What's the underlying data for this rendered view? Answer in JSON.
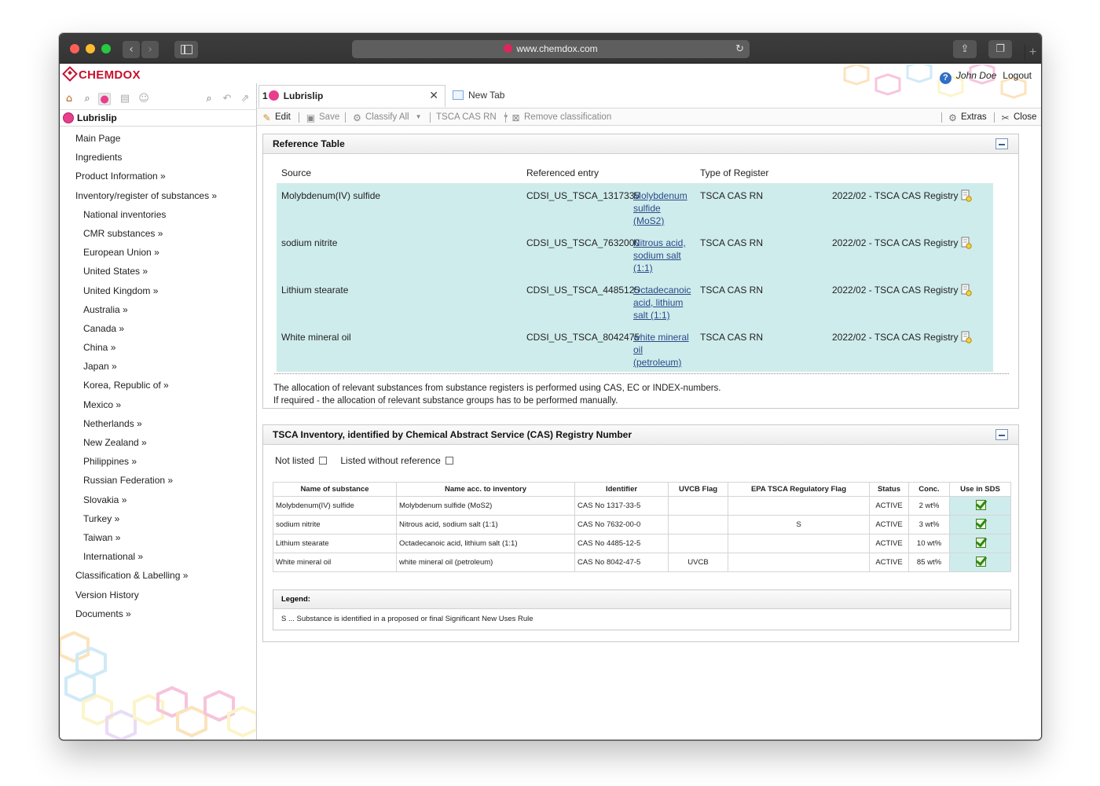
{
  "browser": {
    "url": "www.chemdox.com"
  },
  "app": {
    "logo": "CHEMDOX",
    "user_name": "John Doe",
    "logout": "Logout"
  },
  "left": {
    "title": "Lubrislip",
    "nav": [
      {
        "label": "Main Page",
        "level": 1
      },
      {
        "label": "Ingredients",
        "level": 1
      },
      {
        "label": "Product Information »",
        "level": 1
      },
      {
        "label": "Inventory/register of substances »",
        "level": 1
      },
      {
        "label": "National inventories",
        "level": 2
      },
      {
        "label": "CMR substances »",
        "level": 2
      },
      {
        "label": "European Union »",
        "level": 2
      },
      {
        "label": "United States »",
        "level": 2
      },
      {
        "label": "United Kingdom »",
        "level": 2
      },
      {
        "label": "Australia »",
        "level": 2
      },
      {
        "label": "Canada »",
        "level": 2
      },
      {
        "label": "China »",
        "level": 2
      },
      {
        "label": "Japan »",
        "level": 2
      },
      {
        "label": "Korea, Republic of »",
        "level": 2
      },
      {
        "label": "Mexico »",
        "level": 2
      },
      {
        "label": "Netherlands »",
        "level": 2
      },
      {
        "label": "New Zealand »",
        "level": 2
      },
      {
        "label": "Philippines »",
        "level": 2
      },
      {
        "label": "Russian Federation »",
        "level": 2
      },
      {
        "label": "Slovakia »",
        "level": 2
      },
      {
        "label": "Turkey »",
        "level": 2
      },
      {
        "label": "Taiwan »",
        "level": 2
      },
      {
        "label": "International »",
        "level": 2
      },
      {
        "label": "Classification & Labelling »",
        "level": 1
      },
      {
        "label": "Version History",
        "level": 1
      },
      {
        "label": "Documents »",
        "level": 1
      }
    ]
  },
  "tabs": {
    "active_number": "1",
    "active_label": "Lubrislip",
    "close": "✕",
    "new_tab": "New Tab"
  },
  "toolbar": {
    "edit": "Edit",
    "save": "Save",
    "classify_all": "Classify All",
    "tsca": "TSCA CAS RN",
    "remove": "Remove classification",
    "extras": "Extras",
    "close": "Close"
  },
  "reference": {
    "title": "Reference Table",
    "headers": {
      "source": "Source",
      "entry": "Referenced entry",
      "type": "Type of Register"
    },
    "rows": [
      {
        "source": "Molybdenum(IV) sulfide",
        "id": "CDSI_US_TSCA_1317335",
        "link": [
          "Molybdenum",
          "sulfide",
          "(MoS2)"
        ],
        "type": "TSCA CAS RN",
        "registry": "2022/02 - TSCA CAS Registry"
      },
      {
        "source": "sodium nitrite",
        "id": "CDSI_US_TSCA_7632000",
        "link": [
          "Nitrous acid,",
          "sodium salt",
          "(1:1)"
        ],
        "type": "TSCA CAS RN",
        "registry": "2022/02 - TSCA CAS Registry"
      },
      {
        "source": "Lithium stearate",
        "id": "CDSI_US_TSCA_4485125",
        "link": [
          "Octadecanoic",
          "acid, lithium",
          "salt (1:1)"
        ],
        "type": "TSCA CAS RN",
        "registry": "2022/02 - TSCA CAS Registry"
      },
      {
        "source": "White mineral oil",
        "id": "CDSI_US_TSCA_8042475",
        "link": [
          "white mineral",
          "oil",
          "(petroleum)"
        ],
        "type": "TSCA CAS RN",
        "registry": "2022/02 - TSCA CAS Registry"
      }
    ],
    "note_line1": "The allocation of relevant substances from substance registers is performed using CAS, EC or INDEX-numbers.",
    "note_line2": "If required - the allocation of relevant substance groups has to be performed manually."
  },
  "tsca": {
    "title": "TSCA Inventory, identified by Chemical Abstract Service (CAS) Registry Number",
    "filter_not_listed": "Not listed",
    "filter_without_ref": "Listed without reference",
    "headers": [
      "Name of substance",
      "Name acc. to inventory",
      "Identifier",
      "UVCB Flag",
      "EPA TSCA Regulatory Flag",
      "Status",
      "Conc.",
      "Use in SDS"
    ],
    "rows": [
      {
        "name": "Molybdenum(IV) sulfide",
        "inventory_name": "Molybdenum sulfide (MoS2)",
        "identifier": "CAS No 1317-33-5",
        "uvcb": "",
        "epa_flag": "",
        "status": "ACTIVE",
        "conc": "2 wt%",
        "use_in_sds": true
      },
      {
        "name": "sodium nitrite",
        "inventory_name": "Nitrous acid, sodium salt (1:1)",
        "identifier": "CAS No 7632-00-0",
        "uvcb": "",
        "epa_flag": "S",
        "status": "ACTIVE",
        "conc": "3 wt%",
        "use_in_sds": true
      },
      {
        "name": "Lithium stearate",
        "inventory_name": "Octadecanoic acid, lithium salt (1:1)",
        "identifier": "CAS No 4485-12-5",
        "uvcb": "",
        "epa_flag": "",
        "status": "ACTIVE",
        "conc": "10 wt%",
        "use_in_sds": true
      },
      {
        "name": "White mineral oil",
        "inventory_name": "white mineral oil (petroleum)",
        "identifier": "CAS No 8042-47-5",
        "uvcb": "UVCB",
        "epa_flag": "",
        "status": "ACTIVE",
        "conc": "85 wt%",
        "use_in_sds": true
      }
    ],
    "legend_title": "Legend:",
    "legend_text": "S ... Substance is identified in a proposed or final Significant New Uses Rule"
  }
}
